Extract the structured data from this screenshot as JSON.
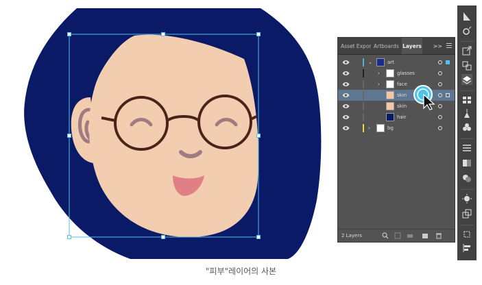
{
  "panel": {
    "tabs": [
      "Asset Expor",
      "Artboards",
      "Layers"
    ],
    "more": ">>",
    "layers": [
      {
        "name": "art",
        "bar_color": "#4fb8d8",
        "thumb_color": "#1f2b8a"
      },
      {
        "name": "glasses",
        "bar_color": "#222222",
        "thumb_color": "#ffffff"
      },
      {
        "name": "face",
        "bar_color": "#666666",
        "thumb_color": "#ffffff"
      },
      {
        "name": "skin",
        "bar_color": "#666666",
        "thumb_color": "#f2c6a7",
        "selected": true
      },
      {
        "name": "skin",
        "bar_color": "#666666",
        "thumb_color": "#f2c6a7"
      },
      {
        "name": "hair",
        "bar_color": "#666666",
        "thumb_color": "#0a1a66"
      },
      {
        "name": "bg",
        "bar_color": "#f5d733",
        "thumb_color": "#ffffff"
      }
    ],
    "footer_label": "2 Layers"
  },
  "caption": "\"피부\"레이어의 사본",
  "colors": {
    "hair": "#0a1a66",
    "skin": "#f2cdb0",
    "selection": "#4fc3e8",
    "glasses": "#4a2418",
    "mouth": "#e07f86"
  }
}
